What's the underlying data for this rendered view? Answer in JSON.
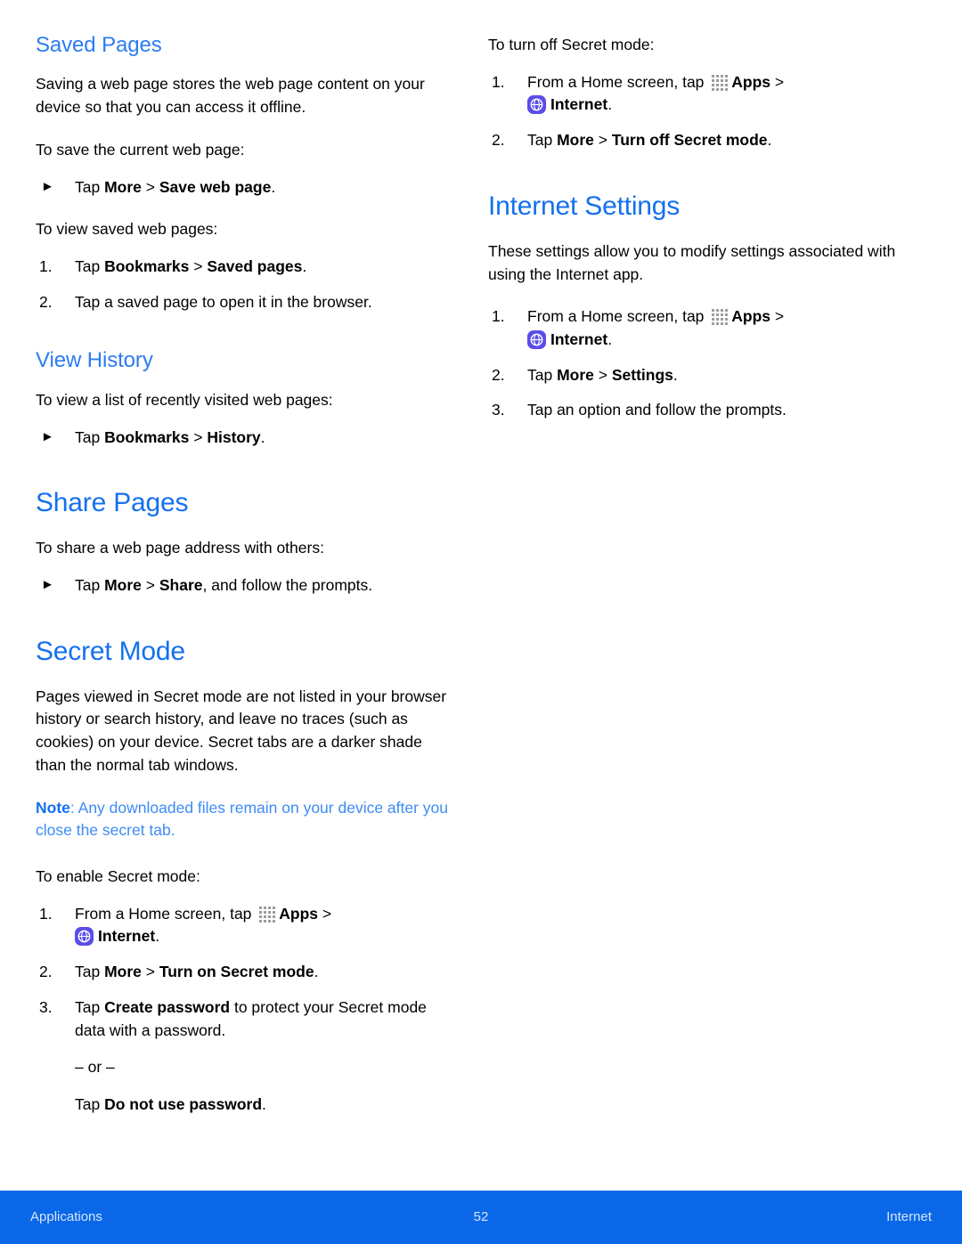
{
  "document": {
    "page_number": "52",
    "footer_left": "Applications",
    "footer_right": "Internet"
  },
  "colors": {
    "heading_major": "#1470EE",
    "heading_minor": "#2B7CF2",
    "note": "#3D8BF5",
    "footer_bar": "#0A67E8",
    "internet_icon": "#5B4DE8",
    "apps_icon_dot": "#9A9A9A"
  },
  "icons": {
    "apps": "apps-grid-icon",
    "internet": "internet-globe-icon",
    "bullet": "►"
  },
  "left_column": {
    "saved_pages": {
      "heading": "Saved Pages",
      "intro": "Saving a web page stores the web page content on your device so that you can access it offline.",
      "save_lead_in": "To save the current web page:",
      "save_step": {
        "marker": "►",
        "pre": "Tap ",
        "b1": "More",
        "sep": " > ",
        "b2": "Save web page",
        "post": "."
      },
      "view_lead_in": "To view saved web pages:",
      "view_steps": [
        {
          "marker": "1.",
          "pre": "Tap ",
          "b1": "Bookmarks",
          "sep": " > ",
          "b2": "Saved pages",
          "post": "."
        },
        {
          "marker": "2.",
          "text": "Tap a saved page to open it in the browser."
        }
      ]
    },
    "view_history": {
      "heading": "View History",
      "lead_in": "To view a list of recently visited web pages:",
      "step": {
        "marker": "►",
        "pre": "Tap ",
        "b1": "Bookmarks",
        "sep": " > ",
        "b2": "History",
        "post": "."
      }
    },
    "share_pages": {
      "heading": "Share Pages",
      "lead_in": "To share a web page address with others:",
      "step": {
        "marker": "►",
        "pre": "Tap ",
        "b1": "More",
        "sep": " > ",
        "b2": "Share",
        "post": ", and follow the prompts."
      }
    },
    "secret_mode": {
      "heading": "Secret Mode",
      "intro": "Pages viewed in Secret mode are not listed in your browser history or search history, and leave no traces (such as cookies) on your device. Secret tabs are a darker shade than the normal tab windows.",
      "note_label": "Note",
      "note_text": ": Any downloaded files remain on your device after you close the secret tab.",
      "enable_lead_in": "To enable Secret mode:",
      "steps": [
        {
          "marker": "1.",
          "pre": "From a Home screen, tap ",
          "apps_label": "Apps",
          "arrow": " > ",
          "internet_label": "Internet",
          "post": "."
        },
        {
          "marker": "2.",
          "pre": "Tap ",
          "b1": "More",
          "sep": " > ",
          "b2": "Turn on Secret mode",
          "post": "."
        },
        {
          "marker": "3.",
          "pre": "Tap ",
          "b1": "Create password",
          "post": " to protect your Secret mode data with a password.",
          "or_line": "– or –",
          "alt_pre": "Tap ",
          "alt_b1": "Do not use password",
          "alt_post": "."
        }
      ]
    }
  },
  "right_column": {
    "secret_mode_off": {
      "lead_in": "To turn off Secret mode:",
      "steps": [
        {
          "marker": "1.",
          "pre": "From a Home screen, tap ",
          "apps_label": "Apps",
          "arrow": " > ",
          "internet_label": "Internet",
          "post": "."
        },
        {
          "marker": "2.",
          "pre": "Tap ",
          "b1": "More",
          "sep": " > ",
          "b2": "Turn off Secret mode",
          "post": "."
        }
      ]
    },
    "internet_settings": {
      "heading": "Internet Settings",
      "intro": "These settings allow you to modify settings associated with using the Internet app.",
      "steps": [
        {
          "marker": "1.",
          "pre": "From a Home screen, tap ",
          "apps_label": "Apps",
          "arrow": " > ",
          "internet_label": "Internet",
          "post": "."
        },
        {
          "marker": "2.",
          "pre": "Tap ",
          "b1": "More",
          "sep": " > ",
          "b2": "Settings",
          "post": "."
        },
        {
          "marker": "3.",
          "text": "Tap an option and follow the prompts."
        }
      ]
    }
  }
}
